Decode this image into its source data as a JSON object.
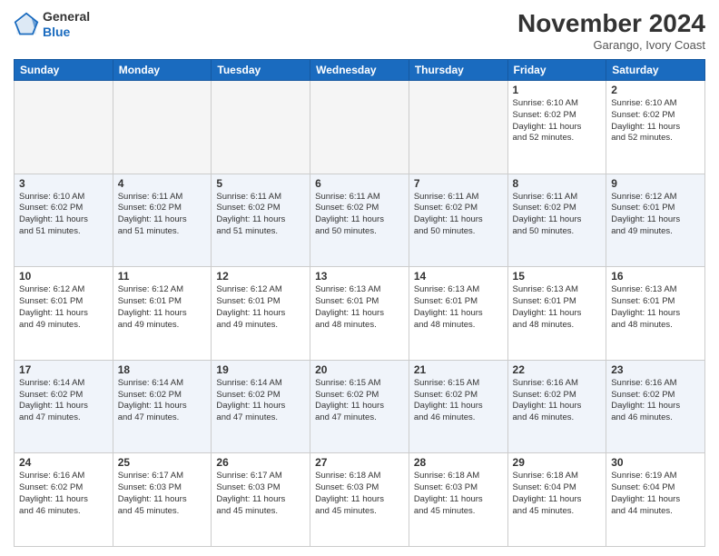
{
  "logo": {
    "line1": "General",
    "line2": "Blue"
  },
  "header": {
    "month": "November 2024",
    "location": "Garango, Ivory Coast"
  },
  "weekdays": [
    "Sunday",
    "Monday",
    "Tuesday",
    "Wednesday",
    "Thursday",
    "Friday",
    "Saturday"
  ],
  "weeks": [
    [
      {
        "day": "",
        "info": ""
      },
      {
        "day": "",
        "info": ""
      },
      {
        "day": "",
        "info": ""
      },
      {
        "day": "",
        "info": ""
      },
      {
        "day": "",
        "info": ""
      },
      {
        "day": "1",
        "info": "Sunrise: 6:10 AM\nSunset: 6:02 PM\nDaylight: 11 hours\nand 52 minutes."
      },
      {
        "day": "2",
        "info": "Sunrise: 6:10 AM\nSunset: 6:02 PM\nDaylight: 11 hours\nand 52 minutes."
      }
    ],
    [
      {
        "day": "3",
        "info": "Sunrise: 6:10 AM\nSunset: 6:02 PM\nDaylight: 11 hours\nand 51 minutes."
      },
      {
        "day": "4",
        "info": "Sunrise: 6:11 AM\nSunset: 6:02 PM\nDaylight: 11 hours\nand 51 minutes."
      },
      {
        "day": "5",
        "info": "Sunrise: 6:11 AM\nSunset: 6:02 PM\nDaylight: 11 hours\nand 51 minutes."
      },
      {
        "day": "6",
        "info": "Sunrise: 6:11 AM\nSunset: 6:02 PM\nDaylight: 11 hours\nand 50 minutes."
      },
      {
        "day": "7",
        "info": "Sunrise: 6:11 AM\nSunset: 6:02 PM\nDaylight: 11 hours\nand 50 minutes."
      },
      {
        "day": "8",
        "info": "Sunrise: 6:11 AM\nSunset: 6:02 PM\nDaylight: 11 hours\nand 50 minutes."
      },
      {
        "day": "9",
        "info": "Sunrise: 6:12 AM\nSunset: 6:01 PM\nDaylight: 11 hours\nand 49 minutes."
      }
    ],
    [
      {
        "day": "10",
        "info": "Sunrise: 6:12 AM\nSunset: 6:01 PM\nDaylight: 11 hours\nand 49 minutes."
      },
      {
        "day": "11",
        "info": "Sunrise: 6:12 AM\nSunset: 6:01 PM\nDaylight: 11 hours\nand 49 minutes."
      },
      {
        "day": "12",
        "info": "Sunrise: 6:12 AM\nSunset: 6:01 PM\nDaylight: 11 hours\nand 49 minutes."
      },
      {
        "day": "13",
        "info": "Sunrise: 6:13 AM\nSunset: 6:01 PM\nDaylight: 11 hours\nand 48 minutes."
      },
      {
        "day": "14",
        "info": "Sunrise: 6:13 AM\nSunset: 6:01 PM\nDaylight: 11 hours\nand 48 minutes."
      },
      {
        "day": "15",
        "info": "Sunrise: 6:13 AM\nSunset: 6:01 PM\nDaylight: 11 hours\nand 48 minutes."
      },
      {
        "day": "16",
        "info": "Sunrise: 6:13 AM\nSunset: 6:01 PM\nDaylight: 11 hours\nand 48 minutes."
      }
    ],
    [
      {
        "day": "17",
        "info": "Sunrise: 6:14 AM\nSunset: 6:02 PM\nDaylight: 11 hours\nand 47 minutes."
      },
      {
        "day": "18",
        "info": "Sunrise: 6:14 AM\nSunset: 6:02 PM\nDaylight: 11 hours\nand 47 minutes."
      },
      {
        "day": "19",
        "info": "Sunrise: 6:14 AM\nSunset: 6:02 PM\nDaylight: 11 hours\nand 47 minutes."
      },
      {
        "day": "20",
        "info": "Sunrise: 6:15 AM\nSunset: 6:02 PM\nDaylight: 11 hours\nand 47 minutes."
      },
      {
        "day": "21",
        "info": "Sunrise: 6:15 AM\nSunset: 6:02 PM\nDaylight: 11 hours\nand 46 minutes."
      },
      {
        "day": "22",
        "info": "Sunrise: 6:16 AM\nSunset: 6:02 PM\nDaylight: 11 hours\nand 46 minutes."
      },
      {
        "day": "23",
        "info": "Sunrise: 6:16 AM\nSunset: 6:02 PM\nDaylight: 11 hours\nand 46 minutes."
      }
    ],
    [
      {
        "day": "24",
        "info": "Sunrise: 6:16 AM\nSunset: 6:02 PM\nDaylight: 11 hours\nand 46 minutes."
      },
      {
        "day": "25",
        "info": "Sunrise: 6:17 AM\nSunset: 6:03 PM\nDaylight: 11 hours\nand 45 minutes."
      },
      {
        "day": "26",
        "info": "Sunrise: 6:17 AM\nSunset: 6:03 PM\nDaylight: 11 hours\nand 45 minutes."
      },
      {
        "day": "27",
        "info": "Sunrise: 6:18 AM\nSunset: 6:03 PM\nDaylight: 11 hours\nand 45 minutes."
      },
      {
        "day": "28",
        "info": "Sunrise: 6:18 AM\nSunset: 6:03 PM\nDaylight: 11 hours\nand 45 minutes."
      },
      {
        "day": "29",
        "info": "Sunrise: 6:18 AM\nSunset: 6:04 PM\nDaylight: 11 hours\nand 45 minutes."
      },
      {
        "day": "30",
        "info": "Sunrise: 6:19 AM\nSunset: 6:04 PM\nDaylight: 11 hours\nand 44 minutes."
      }
    ]
  ]
}
